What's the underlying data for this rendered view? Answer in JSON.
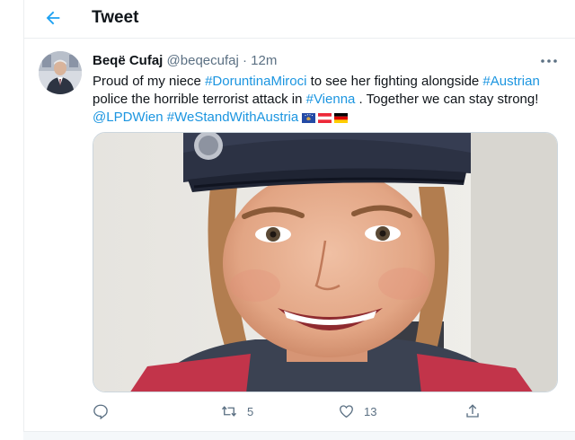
{
  "colors": {
    "accent": "#1b95e0",
    "muted": "#5b7083",
    "text": "#0f1419"
  },
  "header": {
    "title": "Tweet",
    "back_icon": "arrow-left-icon"
  },
  "tweet": {
    "author_name": "Beqë Cufaj",
    "author_handle": "@beqecufaj",
    "separator": "·",
    "time": "12m",
    "text": {
      "p1": "Proud of my niece ",
      "t1": "#DoruntinaMiroci",
      "p2": " to see her fighting alongside ",
      "t2": "#Austrian",
      "p3": " police the horrible terrorist attack in ",
      "t3": "#Vienna",
      "p4": " . Together we can stay strong!",
      "m1": "@LPDWien",
      "t4": "#WeStandWithAustria"
    },
    "flags": [
      "kosovo-flag",
      "austria-flag",
      "germany-flag"
    ],
    "media_description_icon": "photo",
    "actions": {
      "reply_icon": "reply-icon",
      "retweet_icon": "retweet-icon",
      "retweet_count": "5",
      "like_icon": "heart-icon",
      "like_count": "13",
      "share_icon": "share-icon"
    }
  }
}
